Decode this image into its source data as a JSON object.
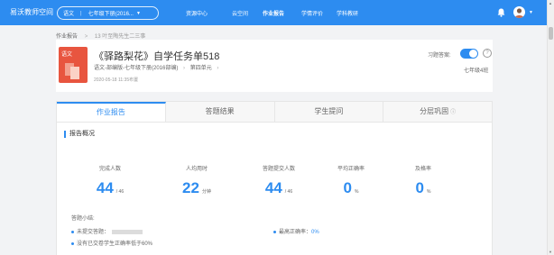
{
  "topbar": {
    "brand": "易沃教师空间",
    "subject": "语文",
    "grade_book": "七年级下册(2016...",
    "nav": [
      "资源中心",
      "云空间",
      "作业报告",
      "学情评价",
      "学科教研"
    ]
  },
  "breadcrumb": [
    "作业报告",
    "13 叶至陶先生二三事"
  ],
  "task": {
    "cover_label": "语文",
    "title": "《驿路梨花》自学任务单518",
    "meta": [
      "语文-部编版-七年级下册(2016部编)",
      "第四单元"
    ],
    "time": "2020-05-18 11:35布置",
    "answer_switch_label": "习题答案:",
    "answer_switch_on": true,
    "class_name": "七年级4班"
  },
  "tabs": [
    "作业报告",
    "答题结果",
    "学生提问",
    "分层巩固"
  ],
  "report": {
    "section_title": "报告概况",
    "stats": [
      {
        "label": "完成人数",
        "value": "44",
        "unit": "/ 46"
      },
      {
        "label": "人均用时",
        "value": "22",
        "unit": "分钟"
      },
      {
        "label": "答题提交人数",
        "value": "44",
        "unit": "/ 46"
      },
      {
        "label": "平均正确率",
        "value": "0",
        "unit": "%"
      },
      {
        "label": "及格率",
        "value": "0",
        "unit": "%"
      }
    ],
    "summary_title": "答题小结:",
    "summary": {
      "unsubmitted": "未提交答题：",
      "lowest_rate_label": "最高正确率：",
      "lowest_rate_value": "0%",
      "below_60": "没有已交卷学生正确率低于60%"
    }
  },
  "colors": {
    "accent": "#2d8cf0",
    "cover": "#e8553f"
  }
}
